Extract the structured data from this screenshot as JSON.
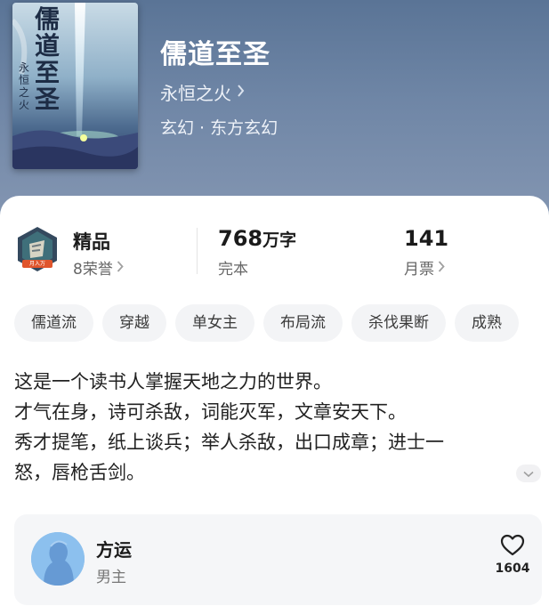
{
  "book": {
    "title": "儒道至圣",
    "author": "永恒之火",
    "genre": "玄幻 · 东方玄幻",
    "cover_title": "儒道至圣",
    "cover_author": "永恒之火"
  },
  "stats": {
    "honor": {
      "label": "精品",
      "sub": "8荣誉",
      "badge_text": "月入万"
    },
    "words": {
      "value": "768",
      "unit": "万字",
      "status": "完本"
    },
    "votes": {
      "value": "141",
      "label": "月票"
    }
  },
  "tags": [
    "儒道流",
    "穿越",
    "单女主",
    "布局流",
    "杀伐果断",
    "成熟"
  ],
  "description": [
    "这是一个读书人掌握天地之力的世界。",
    "才气在身，诗可杀敌，词能灭军，文章安天下。",
    "秀才提笔，纸上谈兵；举人杀敌，出口成章；进士一",
    "怒，唇枪舌剑。"
  ],
  "character": {
    "name": "方运",
    "role": "男主",
    "likes": "1604"
  },
  "icons": {
    "author_chevron": "chevron-right-icon",
    "expand": "chevron-down-icon",
    "like": "heart-outline-icon"
  },
  "colors": {
    "header_bg": "#6a82a3",
    "tag_bg": "#f3f4f6",
    "role_card_bg": "#f5f6f8",
    "avatar_bg": "#8cc0ee"
  }
}
